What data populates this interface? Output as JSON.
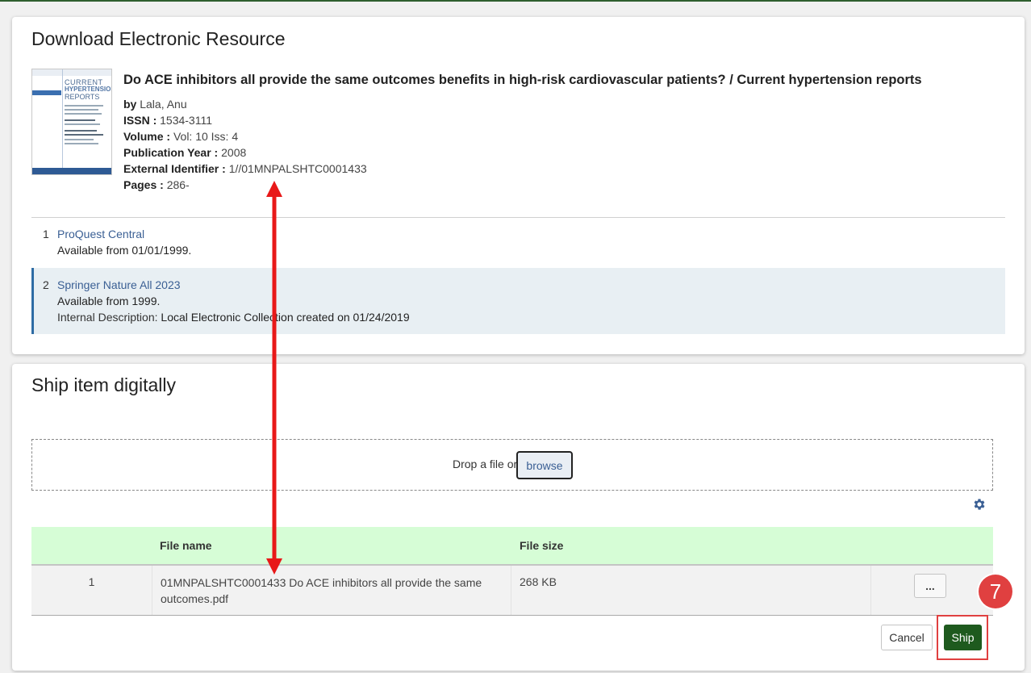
{
  "resource_card": {
    "title": "Download Electronic Resource",
    "cover": {
      "line1": "CURRENT",
      "line2": "HYPERTENSION",
      "line3": "REPORTS"
    },
    "record_title": "Do ACE inhibitors all provide the same outcomes benefits in high-risk cardiovascular patients? / Current hypertension reports",
    "by_label": "by",
    "author": "Lala, Anu",
    "issn_label": "ISSN :",
    "issn": "1534-3111",
    "volume_label": "Volume :",
    "volume": "Vol: 10 Iss: 4",
    "pubyear_label": "Publication Year :",
    "pubyear": "2008",
    "extid_label": "External Identifier :",
    "extid": "1//01MNPALSHTC0001433",
    "pages_label": "Pages :",
    "pages": "286-",
    "resources": [
      {
        "num": "1",
        "name": "ProQuest Central",
        "availability": "Available from 01/01/1999."
      },
      {
        "num": "2",
        "name": "Springer Nature All 2023",
        "availability": "Available from 1999.",
        "desc_label": "Internal Description:",
        "desc_value": "Local Electronic Collection created on 01/24/2019"
      }
    ]
  },
  "ship_card": {
    "title": "Ship item digitally",
    "drop_text": "Drop a file or",
    "browse_label": "browse",
    "table": {
      "headers": [
        "",
        "File name",
        "File size",
        ""
      ],
      "rows": [
        {
          "num": "1",
          "file_name": "01MNPALSHTC0001433 Do ACE inhibitors all provide the same outcomes.pdf",
          "file_size": "268 KB",
          "actions_label": "..."
        }
      ]
    },
    "cancel_label": "Cancel",
    "ship_label": "Ship"
  },
  "annotation": {
    "step_number": "7",
    "color": "#e04040"
  },
  "colors": {
    "link": "#3a5f94",
    "ship_button": "#1e5a1e",
    "table_header": "#d6fdd6",
    "selected_row": "#e8eff3"
  }
}
